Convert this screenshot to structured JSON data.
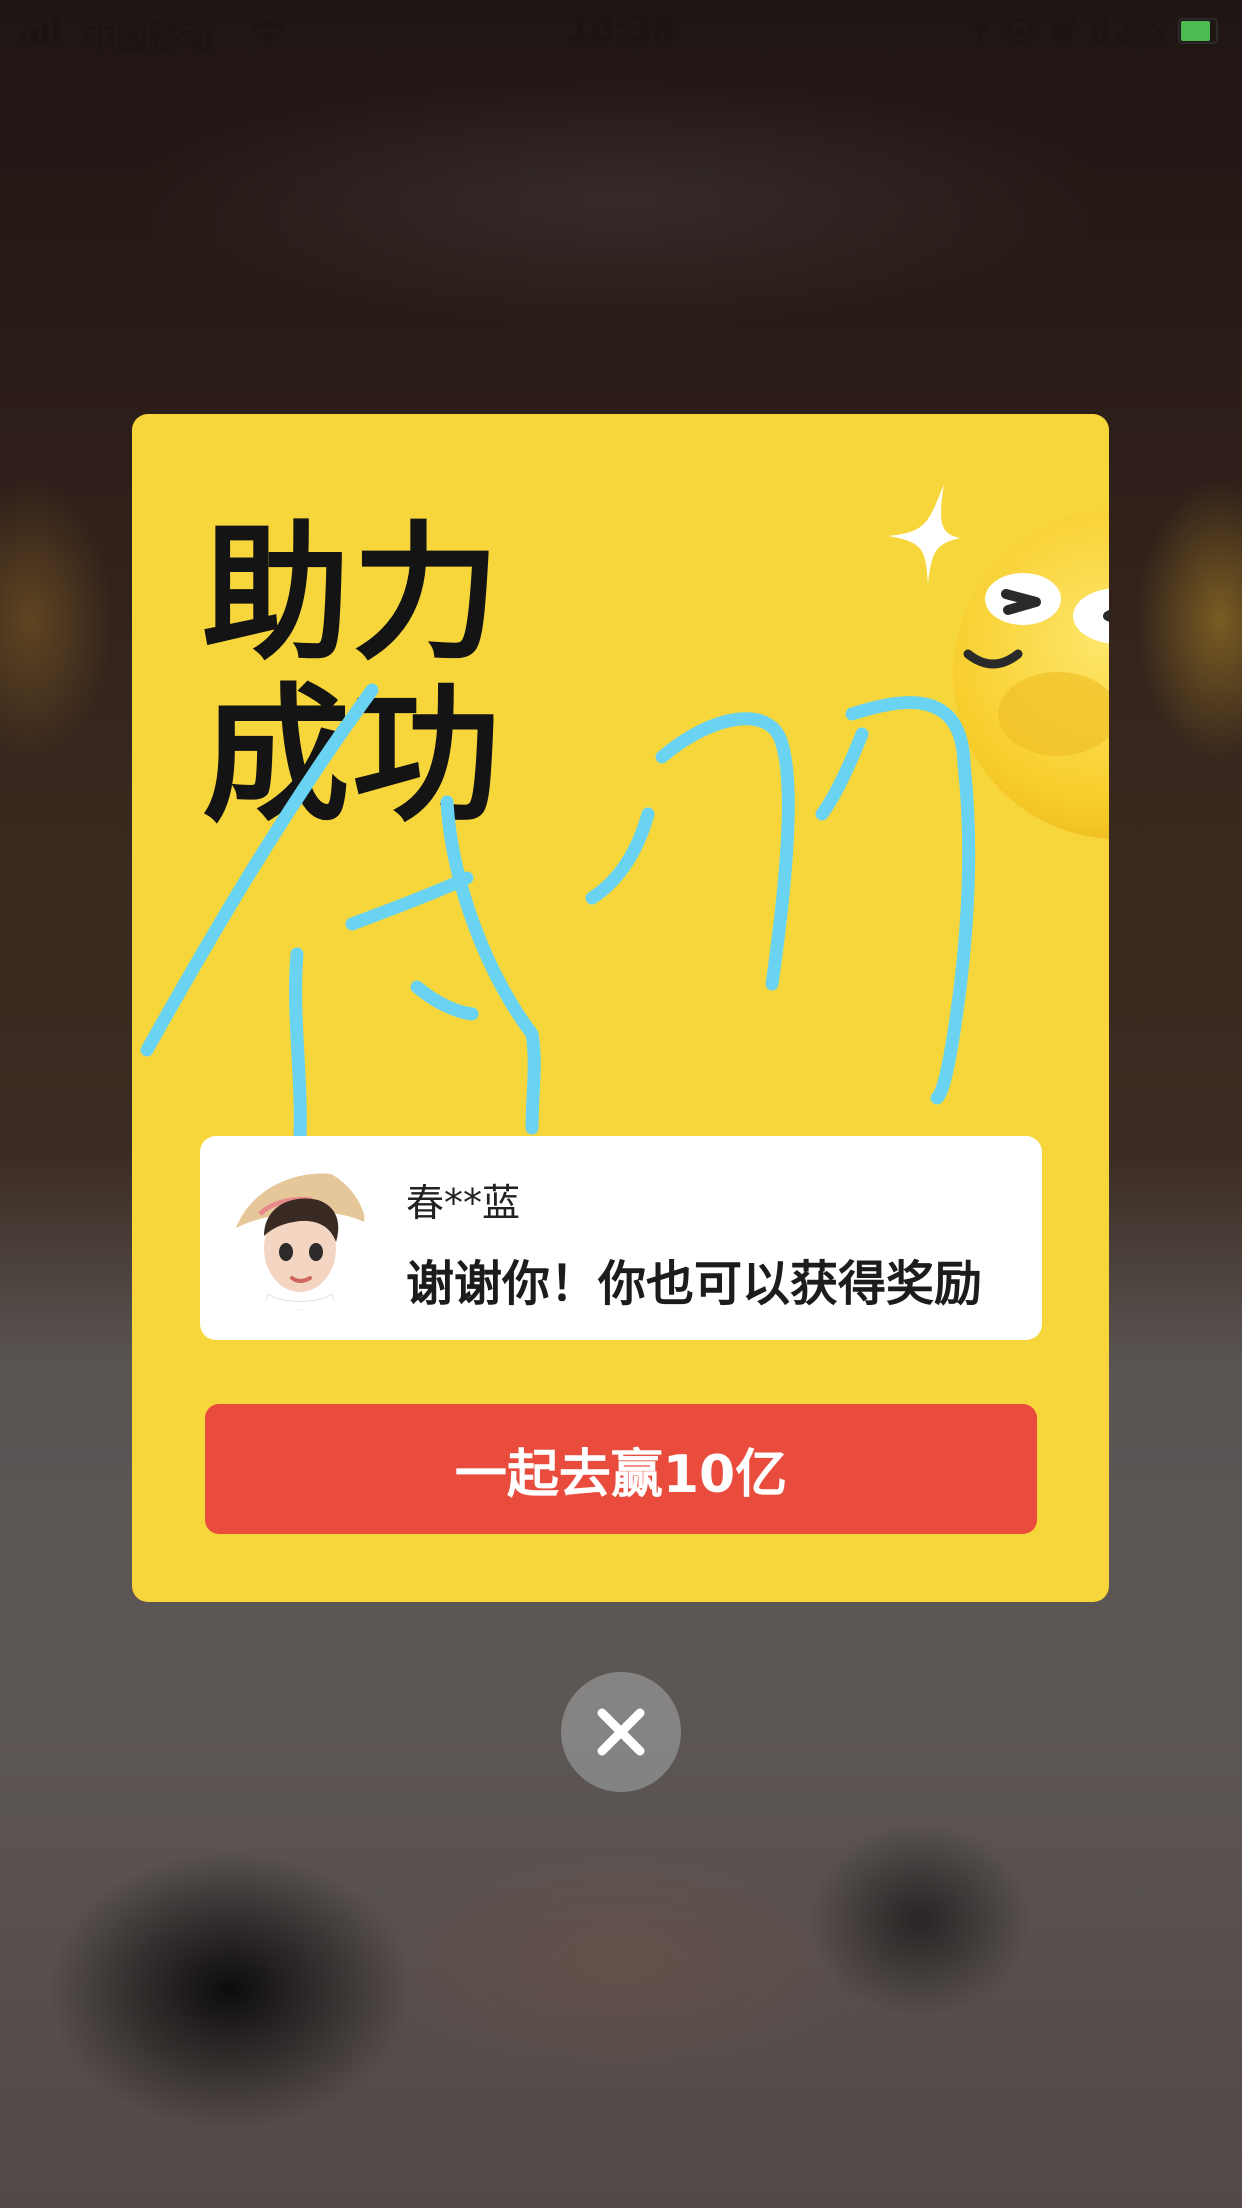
{
  "status_bar": {
    "carrier": "中国移动",
    "time": "10:38",
    "battery_percent": "82%",
    "icons": [
      "signal-icon",
      "wifi-icon",
      "location-arrow-icon",
      "orientation-lock-icon",
      "alarm-icon",
      "battery-charging-icon"
    ]
  },
  "dialog": {
    "title_line1": "助力",
    "title_line2": "成功",
    "background_color": "#f7d63b",
    "decorations": [
      "winking-emoji",
      "sparkle-icon",
      "handwritten-scribble"
    ],
    "message": {
      "sender_name": "春**蓝",
      "text": "谢谢你！你也可以获得奖励"
    },
    "action_button_label": "一起去赢10亿",
    "action_button_color": "#e94b3c"
  },
  "close_button": {
    "icon": "close-icon"
  }
}
